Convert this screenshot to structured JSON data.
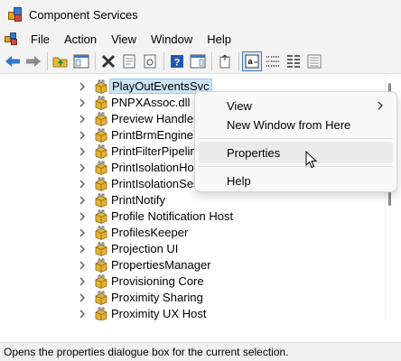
{
  "window": {
    "title": "Component Services"
  },
  "menubar": {
    "items": [
      "File",
      "Action",
      "View",
      "Window",
      "Help"
    ]
  },
  "toolbar": {
    "buttons": [
      "back-arrow-icon",
      "forward-arrow-icon",
      "up-folder-icon",
      "show-hide-console-tree-icon",
      "delete-icon",
      "properties-sheet-icon",
      "refresh-icon",
      "help-icon",
      "show-hide-action-pane-icon",
      "export-list-icon",
      "large-icons-view-icon",
      "small-icons-view-icon",
      "list-view-icon",
      "detail-view-icon"
    ]
  },
  "tree": {
    "items": [
      {
        "label": "PlayOutEventsSvc",
        "selected": true
      },
      {
        "label": "PNPXAssoc.dll"
      },
      {
        "label": "Preview Handler S"
      },
      {
        "label": "PrintBrmEngine"
      },
      {
        "label": "PrintFilterPipeline"
      },
      {
        "label": "PrintIsolationHost"
      },
      {
        "label": "PrintIsolationSess"
      },
      {
        "label": "PrintNotify"
      },
      {
        "label": "Profile Notification Host"
      },
      {
        "label": "ProfilesKeeper"
      },
      {
        "label": "Projection UI"
      },
      {
        "label": "PropertiesManager"
      },
      {
        "label": "Provisioning Core"
      },
      {
        "label": "Proximity Sharing"
      },
      {
        "label": "Proximity UX Host"
      }
    ]
  },
  "context_menu": {
    "view": "View",
    "new_window": "New Window from Here",
    "properties": "Properties",
    "help": "Help"
  },
  "statusbar": {
    "text": "Opens the properties dialogue box for the current selection."
  },
  "colors": {
    "selection": "#cce4f7",
    "accent": "#3b79c6",
    "package": "#d9a72a"
  }
}
